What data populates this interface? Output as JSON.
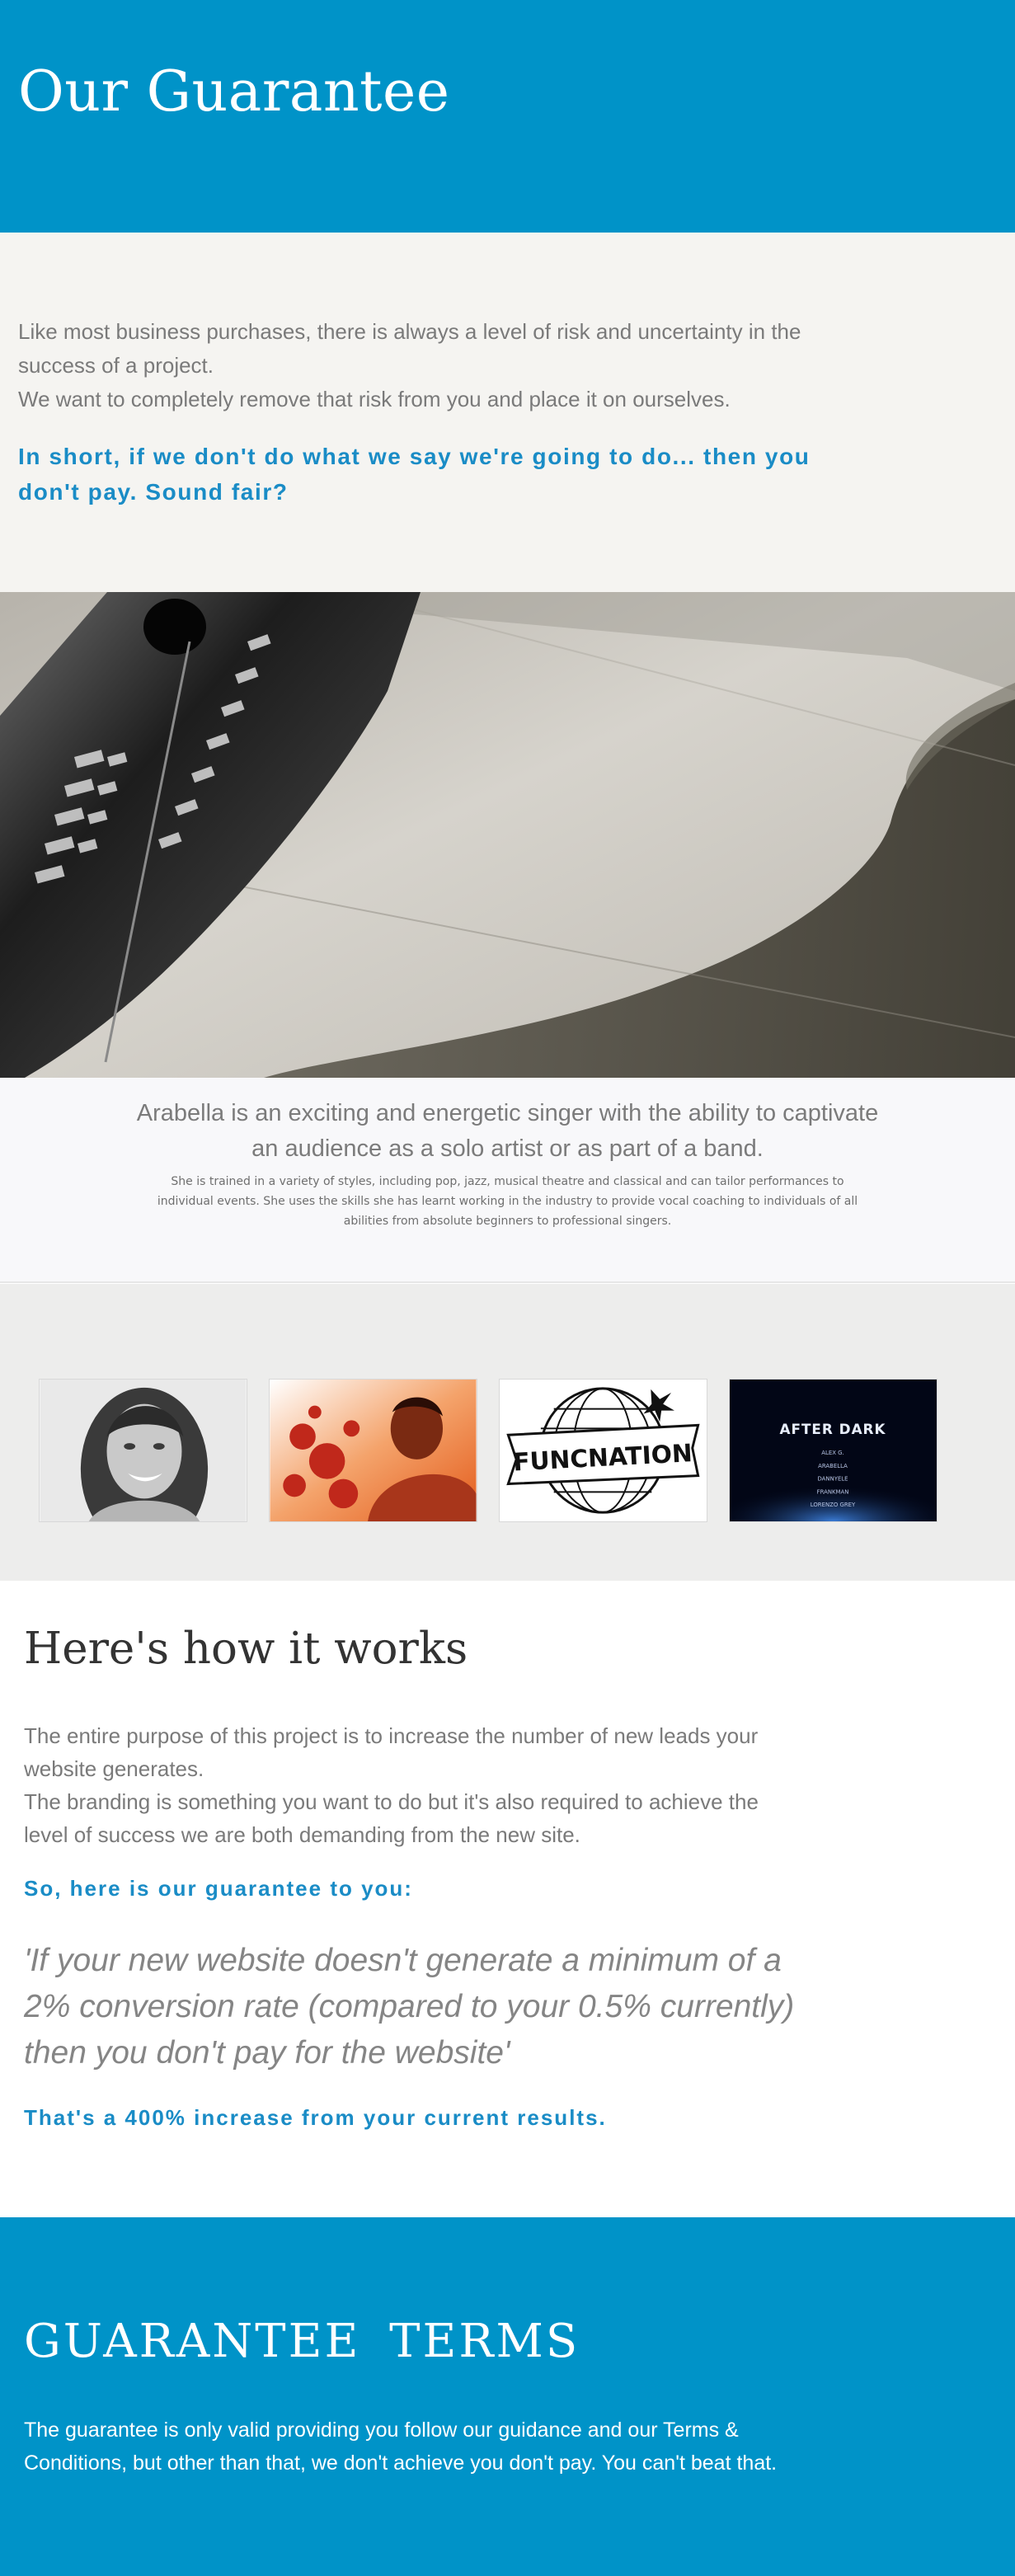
{
  "hero": {
    "title": "Our Guarantee",
    "bg_color": "#0093c8"
  },
  "intro": {
    "paragraph1": "Like most business purchases, there is always a level of risk and uncertainty in the success of a project.",
    "paragraph2": "We want to completely remove that risk from you and place it on ourselves.",
    "emphasis": "In short, if we don't do what we say we're going to do... then you don't pay. Sound fair?"
  },
  "photo": {
    "icon": "fountain-pen-nib-photo"
  },
  "artist": {
    "lead": "Arabella is an exciting and energetic singer with the ability to captivate an audience as a solo artist or as part of a band.",
    "detail": "She is trained in a variety of styles, including pop, jazz, musical theatre and classical and can tailor performances to individual events. She uses the skills she has learnt working in the industry to provide vocal coaching to individuals of all abilities from absolute beginners to professional singers."
  },
  "thumbnails": {
    "items": [
      {
        "icon": "woman-portrait-photo"
      },
      {
        "icon": "man-fire-splash-photo"
      },
      {
        "icon": "funcnation-globe-logo",
        "logo_text": "FUNCNATION"
      },
      {
        "icon": "after-dark-poster",
        "poster_title": "AFTER DARK",
        "poster_names": [
          "ALEX G.",
          "ARABELLA",
          "DANNYELE",
          "FRANKMAN",
          "LORENZO GREY"
        ]
      }
    ]
  },
  "how": {
    "title": "Here's how it works",
    "paragraph1": "The entire purpose of this project is to increase the number of new leads your website generates.",
    "paragraph2": "The branding is something you want to do but it's also required to achieve the level of success we are both demanding from the new site.",
    "subheading": "So, here is our guarantee to you:",
    "quote": "'If your new website doesn't generate a minimum of a 2% conversion rate (compared to your 0.5% currently) then you don't pay for the website'",
    "tagline": "That's a 400% increase from your current results."
  },
  "terms": {
    "title": "GUARANTEE TERMS",
    "body": "The guarantee is only valid providing you follow our guidance and our Terms & Conditions, but other than that, we don't achieve you don't pay. You can't beat that."
  },
  "colors": {
    "accent": "#1a8cc6",
    "brand_blue": "#0093c8"
  }
}
